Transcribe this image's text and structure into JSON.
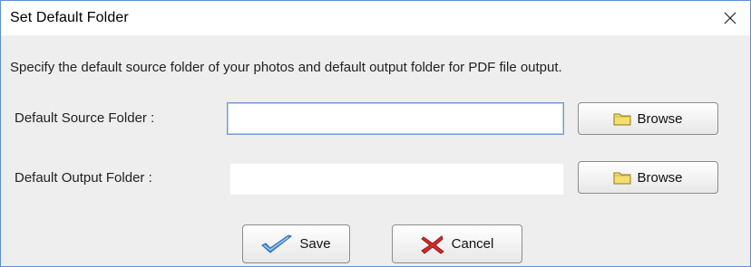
{
  "window": {
    "title": "Set Default Folder",
    "close_glyph": "✕"
  },
  "dialog": {
    "description": "Specify the default source folder of your photos and default output folder for PDF file output.",
    "source": {
      "label": "Default Source Folder :",
      "value": "",
      "browse_label": "Browse",
      "icon": "folder-icon"
    },
    "output": {
      "label": "Default Output Folder :",
      "value": "",
      "browse_label": "Browse",
      "icon": "folder-icon"
    },
    "save": {
      "label": "Save",
      "icon": "checkmark-icon"
    },
    "cancel": {
      "label": "Cancel",
      "icon": "cross-icon"
    }
  },
  "colors": {
    "window_border": "#5b8fd1",
    "content_bg": "#eeeeee",
    "folder_fill": "#f5df6b",
    "check_fill": "#4a90d9",
    "cross_fill": "#d62a2a"
  }
}
